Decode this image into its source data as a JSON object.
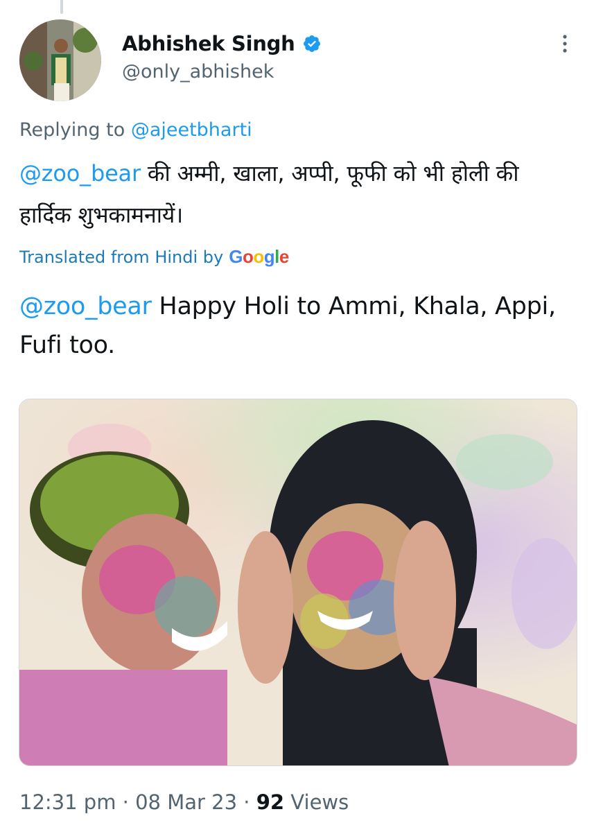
{
  "author": {
    "display_name": "Abhishek Singh",
    "handle": "@only_abhishek",
    "verified": true,
    "verified_icon": "verified-badge-icon"
  },
  "reply": {
    "prefix": "Replying to ",
    "to": "@ajeetbharti"
  },
  "tweet": {
    "mention": "@zoo_bear",
    "text": " की अम्मी, खाला, अप्पी, फूफी को भी होली की हार्दिक शुभकामनायें।"
  },
  "translation": {
    "label": "Translated from Hindi by",
    "provider": "Google",
    "mention": "@zoo_bear",
    "text": " Happy Holi to Ammi, Khala, Appi, Fufi too."
  },
  "meta": {
    "time": "12:31 pm",
    "separator": " · ",
    "date": "08 Mar 23",
    "views_count": "92",
    "views_label": " Views"
  },
  "colors": {
    "accent": "#1d9bf0",
    "secondary_text": "#536471",
    "verified": "#1d9bf0",
    "translated_link": "#1d7ab8"
  }
}
